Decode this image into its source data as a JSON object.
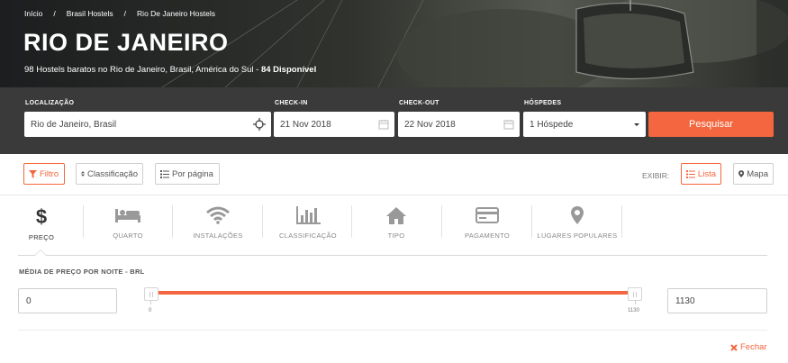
{
  "hero": {
    "breadcrumb": [
      "Início",
      "Brasil Hostels",
      "Rio De Janeiro Hostels"
    ],
    "title": "RIO DE JANEIRO",
    "subtitle_text": "98 Hostels baratos no Rio de Janeiro, Brasil, América do Sul - ",
    "subtitle_bold": "84 Disponível"
  },
  "search": {
    "location_label": "LOCALIZAÇÃO",
    "location_value": "Rio de Janeiro, Brasil",
    "checkin_label": "CHECK-IN",
    "checkin_value": "21 Nov 2018",
    "checkout_label": "CHECK-OUT",
    "checkout_value": "22 Nov 2018",
    "guests_label": "HÓSPEDES",
    "guests_value": "1 Hóspede",
    "search_button": "Pesquisar"
  },
  "toolbar": {
    "filter_label": "Filtro",
    "sort_label": "Classificação",
    "per_page_label": "Por página",
    "view_label": "EXIBIR:",
    "list_label": "Lista",
    "map_label": "Mapa"
  },
  "filter_tabs": [
    {
      "label": "PREÇO",
      "icon": "dollar-icon"
    },
    {
      "label": "QUARTO",
      "icon": "bed-icon"
    },
    {
      "label": "INSTALAÇÕES",
      "icon": "wifi-icon"
    },
    {
      "label": "CLASSIFICAÇÃO",
      "icon": "bar-chart-icon"
    },
    {
      "label": "TIPO",
      "icon": "home-icon"
    },
    {
      "label": "PAGAMENTO",
      "icon": "credit-card-icon"
    },
    {
      "label": "LUGARES POPULARES",
      "icon": "map-marker-icon"
    }
  ],
  "price": {
    "title": "MÉDIA DE PREÇO POR NOITE - BRL",
    "min_value": "0",
    "max_value": "1130",
    "scale_min": "0",
    "scale_max": "1130",
    "close_label": "Fechar"
  },
  "colors": {
    "accent": "#f4663f",
    "searchbar_bg": "#3a3a3a"
  }
}
